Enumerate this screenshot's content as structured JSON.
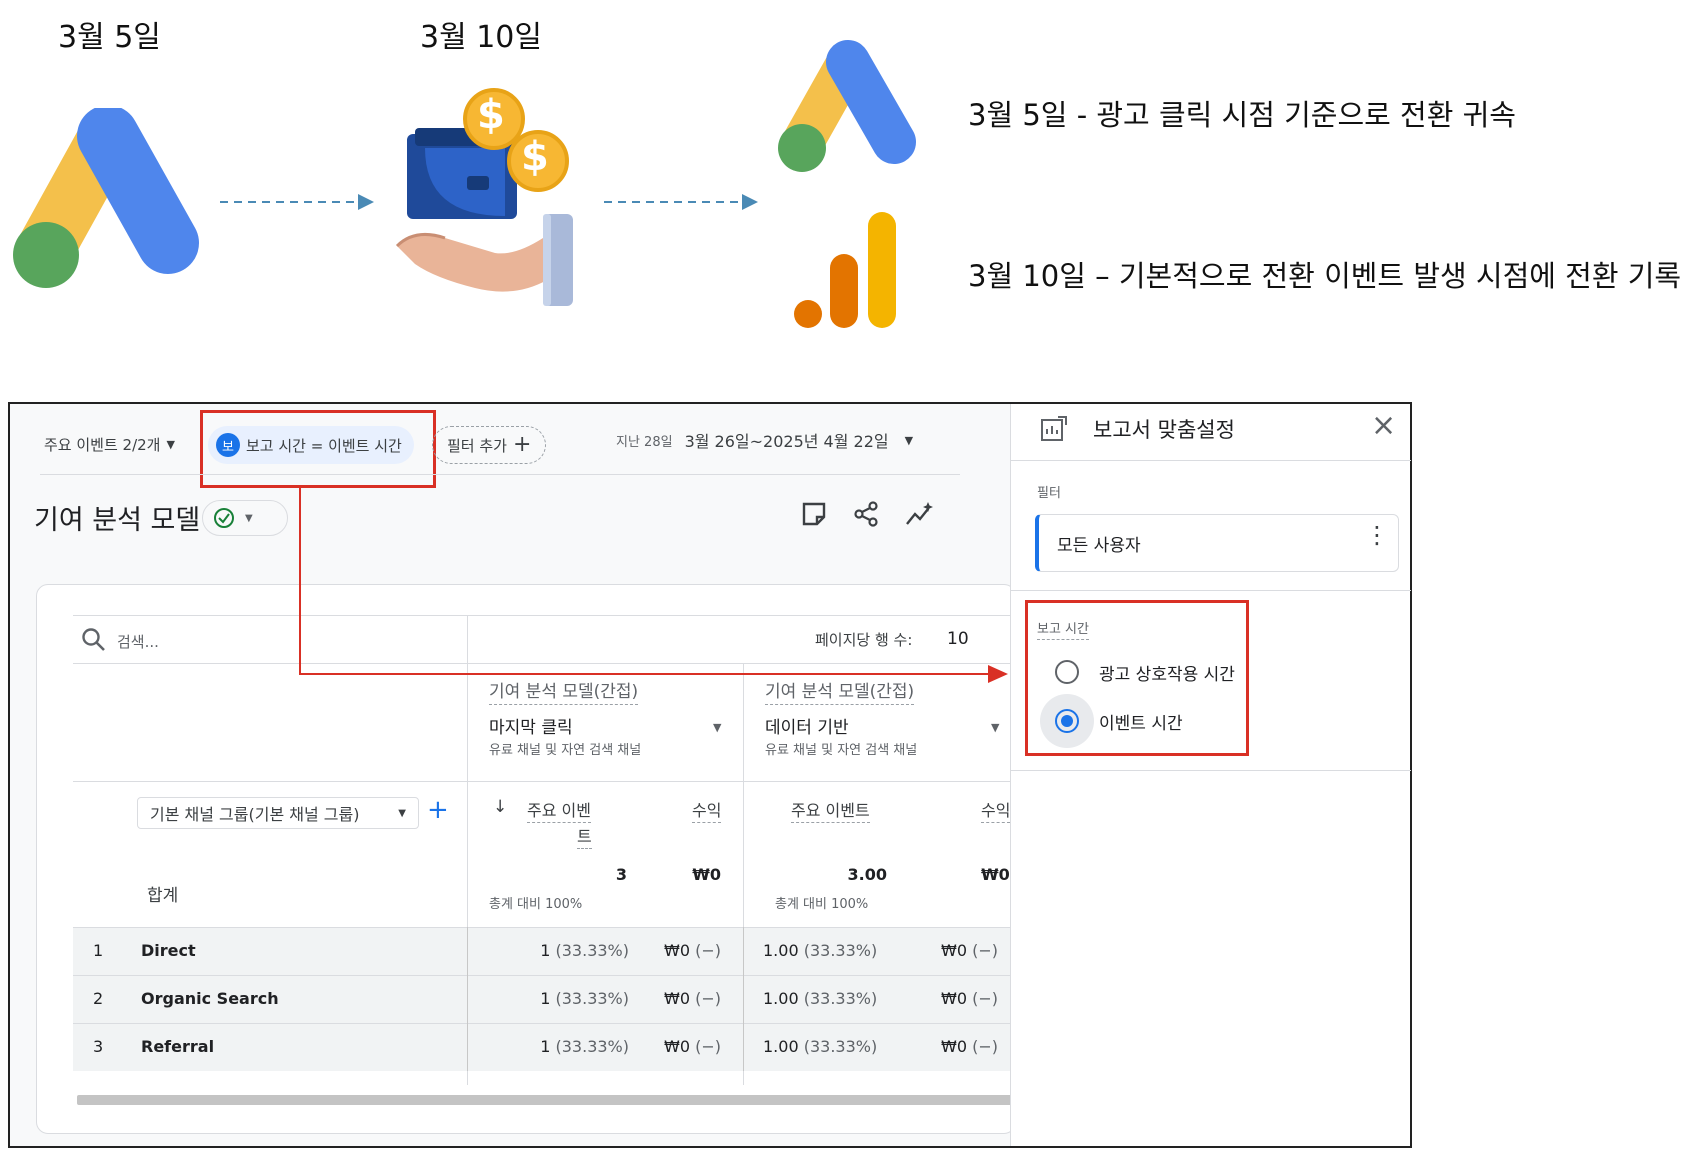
{
  "top": {
    "date1": "3월 5일",
    "date2": "3월 10일",
    "note1": "3월 5일 - 광고 클릭 시점 기준으로 전환 귀속",
    "note2": "3월 10일 – 기본적으로 전환 이벤트 발생 시점에 전환 기록",
    "coin_symbol": "$"
  },
  "toolbar": {
    "key_events": "주요 이벤트 2/2개",
    "condition_badge": "보",
    "condition": "보고 시간 = 이벤트 시간",
    "add_filter": "필터 추가",
    "range_label": "지난 28일",
    "range": "3월 26일~2025년 4월 22일"
  },
  "title": "기여 분석 모델",
  "table": {
    "search_placeholder": "검색...",
    "rows_per_page_label": "페이지당 행 수:",
    "rows_per_page": "10",
    "col_group_label": "기여 분석 모델(간접)",
    "model1": "마지막 클릭",
    "model2": "데이터 기반",
    "model_sub": "유료 채널 및 자연 검색 채널",
    "dimension": "기본 채널 그룹(기본 채널 그룹)",
    "metric_key_events_a": "주요 이벤",
    "metric_key_events_b": "트",
    "metric_revenue": "수익",
    "metric_key_events": "주요 이벤트",
    "metric_revenue_cut": "수익",
    "total_label": "합계",
    "total_m1_key": "3",
    "total_m1_rev": "₩0",
    "total_m2_key": "3.00",
    "total_m2_rev": "₩0",
    "total_share": "총계 대비 100%",
    "rows": [
      {
        "idx": "1",
        "name": "Direct",
        "m1_key": "1",
        "m1_pct": "(33.33%)",
        "m1_rev": "₩0",
        "m1_rev_pct": "(−)",
        "m2_key": "1.00",
        "m2_pct": "(33.33%)",
        "m2_rev": "₩0",
        "m2_rev_pct": "(−)"
      },
      {
        "idx": "2",
        "name": "Organic Search",
        "m1_key": "1",
        "m1_pct": "(33.33%)",
        "m1_rev": "₩0",
        "m1_rev_pct": "(−)",
        "m2_key": "1.00",
        "m2_pct": "(33.33%)",
        "m2_rev": "₩0",
        "m2_rev_pct": "(−)"
      },
      {
        "idx": "3",
        "name": "Referral",
        "m1_key": "1",
        "m1_pct": "(33.33%)",
        "m1_rev": "₩0",
        "m1_rev_pct": "(−)",
        "m2_key": "1.00",
        "m2_pct": "(33.33%)",
        "m2_rev": "₩0",
        "m2_rev_pct": "(−)"
      }
    ]
  },
  "panel": {
    "title": "보고서 맞춤설정",
    "filter_label": "필터",
    "filter_value": "모든 사용자",
    "report_time_label": "보고 시간",
    "option1": "광고 상호작용 시간",
    "option2": "이벤트 시간",
    "selected": "이벤트 시간"
  },
  "colors": {
    "accent": "#1a73e8",
    "highlight": "#d93025",
    "ads_blue": "#4285f4",
    "ads_yellow": "#f4b400",
    "ads_green": "#34a853",
    "ga_orange": "#e37400"
  }
}
